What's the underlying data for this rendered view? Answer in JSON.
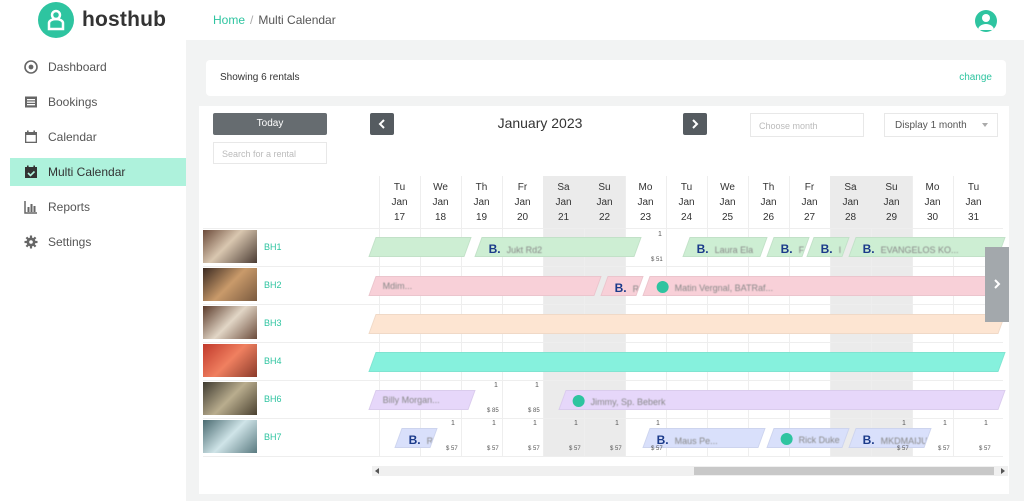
{
  "app": {
    "brand": "hosthub"
  },
  "breadcrumb": {
    "home": "Home",
    "current": "Multi Calendar"
  },
  "sidebar": {
    "items": [
      {
        "label": "Dashboard",
        "icon": "dashboard-icon",
        "active": false
      },
      {
        "label": "Bookings",
        "icon": "list-icon",
        "active": false
      },
      {
        "label": "Calendar",
        "icon": "calendar-icon",
        "active": false
      },
      {
        "label": "Multi Calendar",
        "icon": "multi-calendar-icon",
        "active": true
      },
      {
        "label": "Reports",
        "icon": "chart-icon",
        "active": false
      },
      {
        "label": "Settings",
        "icon": "gear-icon",
        "active": false
      }
    ]
  },
  "summary": {
    "text": "Showing 6 rentals",
    "change_label": "change"
  },
  "toolbar": {
    "today_label": "Today",
    "search_placeholder": "Search for a rental",
    "month_title": "January 2023",
    "choose_month_placeholder": "Choose month",
    "display_label": "Display 1 month"
  },
  "days": [
    {
      "dow": "Tu",
      "mon": "Jan",
      "day": "17",
      "weekend": false
    },
    {
      "dow": "We",
      "mon": "Jan",
      "day": "18",
      "weekend": false
    },
    {
      "dow": "Th",
      "mon": "Jan",
      "day": "19",
      "weekend": false
    },
    {
      "dow": "Fr",
      "mon": "Jan",
      "day": "20",
      "weekend": false
    },
    {
      "dow": "Sa",
      "mon": "Jan",
      "day": "21",
      "weekend": true
    },
    {
      "dow": "Su",
      "mon": "Jan",
      "day": "22",
      "weekend": true
    },
    {
      "dow": "Mo",
      "mon": "Jan",
      "day": "23",
      "weekend": false
    },
    {
      "dow": "Tu",
      "mon": "Jan",
      "day": "24",
      "weekend": false
    },
    {
      "dow": "We",
      "mon": "Jan",
      "day": "25",
      "weekend": false
    },
    {
      "dow": "Th",
      "mon": "Jan",
      "day": "26",
      "weekend": false
    },
    {
      "dow": "Fr",
      "mon": "Jan",
      "day": "27",
      "weekend": false
    },
    {
      "dow": "Sa",
      "mon": "Jan",
      "day": "28",
      "weekend": true
    },
    {
      "dow": "Su",
      "mon": "Jan",
      "day": "29",
      "weekend": true
    },
    {
      "dow": "Mo",
      "mon": "Jan",
      "day": "30",
      "weekend": false
    },
    {
      "dow": "Tu",
      "mon": "Jan",
      "day": "31",
      "weekend": false
    }
  ],
  "rentals": [
    {
      "name": "BH1"
    },
    {
      "name": "BH2"
    },
    {
      "name": "BH3"
    },
    {
      "name": "BH4"
    },
    {
      "name": "BH6"
    },
    {
      "name": "BH7"
    }
  ],
  "bookings": {
    "bh1_a": {
      "mark": "B.",
      "guest": "Jukt Rd2"
    },
    "bh1_b": {
      "mark": "B.",
      "guest": "Laura Ela"
    },
    "bh1_c": {
      "mark": "B.",
      "guest": "F"
    },
    "bh1_d": {
      "mark": "B.",
      "guest": "I"
    },
    "bh1_e": {
      "mark": "B.",
      "guest": "EVANGELOS KO..."
    },
    "bh2_a": {
      "guest": "Mdim..."
    },
    "bh2_b": {
      "mark": "B.",
      "guest": "R"
    },
    "bh2_c": {
      "guest": "Matin Vergnal, BATRaf..."
    },
    "bh6_a": {
      "guest": "Billy Morgan..."
    },
    "bh6_b": {
      "guest": "Jimmy, Sp. Beberk"
    },
    "bh7_a": {
      "mark": "B.",
      "guest": "R"
    },
    "bh7_b": {
      "mark": "B.",
      "guest": "Maus Pe..."
    },
    "bh7_c": {
      "guest": "Rick Duke"
    },
    "bh7_d": {
      "mark": "B.",
      "guest": "MKDMAIJU"
    }
  },
  "cells": {
    "bh1_mo23_avail": "1",
    "bh1_mo23_price": "$ 51",
    "bh6_fr20_avail": "1",
    "bh6_fr20_price": "$ 85",
    "bh6_th19_avail": "1",
    "bh6_th19_price": "$ 85",
    "bh7_avail": "1",
    "bh7_price": "$ 57"
  },
  "colors": {
    "accent": "#2ec4a0",
    "green": "#cdeed3",
    "pink": "#f8d0d8",
    "peach": "#fde5d2",
    "teal": "#86f1dd",
    "lavender": "#e6d7fa",
    "blue": "#d9e0fb"
  }
}
